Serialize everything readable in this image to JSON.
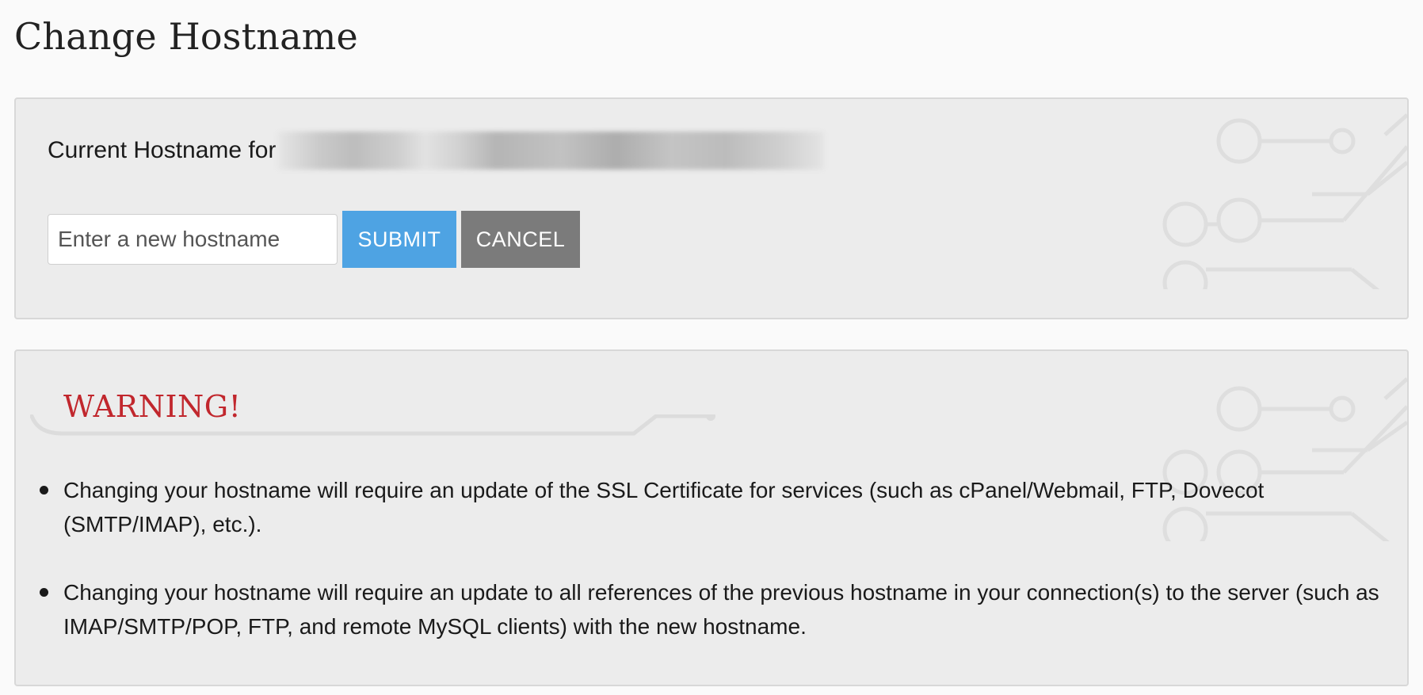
{
  "page": {
    "title": "Change Hostname"
  },
  "hostname_panel": {
    "current_label": "Current Hostname for",
    "input_placeholder": "Enter a new hostname",
    "input_value": "",
    "submit_label": "SUBMIT",
    "cancel_label": "CANCEL"
  },
  "warning_panel": {
    "title": "WARNING!",
    "items": [
      "Changing your hostname will require an update of the SSL Certificate for services (such as cPanel/Webmail, FTP, Dovecot (SMTP/IMAP), etc.).",
      "Changing your hostname will require an update to all references of the previous hostname in your connection(s) to the server (such as IMAP/SMTP/POP, FTP, and remote MySQL clients) with the new hostname."
    ]
  },
  "colors": {
    "submit_button": "#4ea3e3",
    "cancel_button": "#7b7b7b",
    "warning_title": "#c1272d",
    "panel_background": "#ececec"
  },
  "icons": {
    "background_decoration": "circuit-board-decoration"
  }
}
